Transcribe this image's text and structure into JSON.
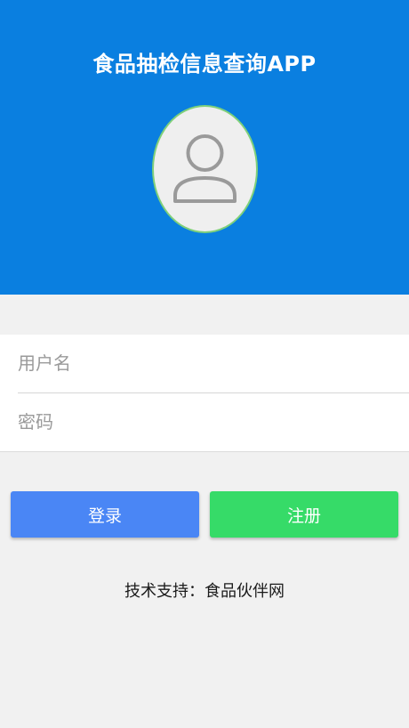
{
  "header": {
    "title": "食品抽检信息查询APP",
    "background_color": "#0a7fe0",
    "avatar_icon": "user-icon"
  },
  "login_form": {
    "username_placeholder": "用户名",
    "password_placeholder": "密码"
  },
  "buttons": {
    "login_label": "登录",
    "login_color": "#4a86f5",
    "register_label": "注册",
    "register_color": "#36db68"
  },
  "footer": {
    "support_text": "技术支持：食品伙伴网"
  }
}
